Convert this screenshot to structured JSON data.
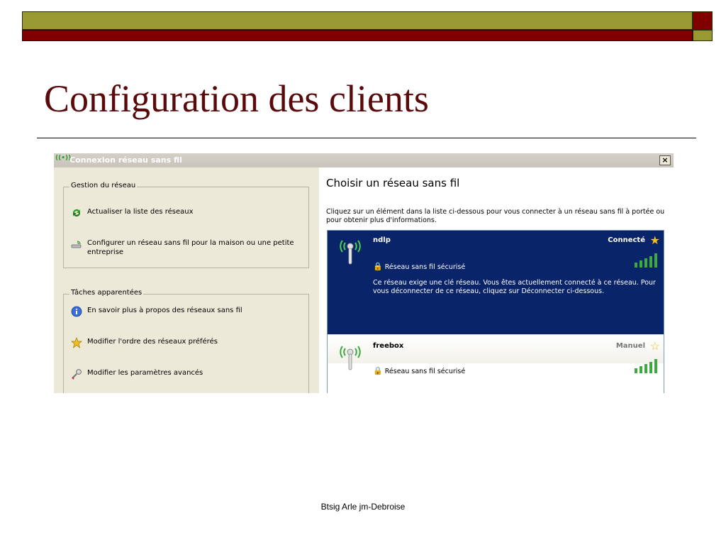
{
  "slide": {
    "title": "Configuration des clients",
    "footer": "Btsig Arle jm-Debroise"
  },
  "window": {
    "title": "Connexion réseau sans fil",
    "close_label": "×"
  },
  "left_pane": {
    "group1": {
      "legend": "Gestion du réseau",
      "items": [
        {
          "label": "Actualiser la liste des réseaux",
          "icon": "refresh-icon"
        },
        {
          "label": "Configurer un réseau sans fil pour la maison ou une petite entreprise",
          "icon": "wireless-setup-icon"
        }
      ]
    },
    "group2": {
      "legend": "Tâches apparentées",
      "items": [
        {
          "label": "En savoir plus à propos des réseaux sans fil",
          "icon": "info-icon"
        },
        {
          "label": "Modifier l'ordre des réseaux préférés",
          "icon": "star-icon"
        },
        {
          "label": "Modifier les paramètres avancés",
          "icon": "settings-icon"
        }
      ]
    }
  },
  "right_pane": {
    "title": "Choisir un réseau sans fil",
    "description": "Cliquez sur un élément dans la liste ci-dessous pour vous connecter à un réseau sans fil à portée ou pour obtenir plus d'informations.",
    "networks": [
      {
        "name": "ndlp",
        "status": "Connecté",
        "security": "Réseau sans fil sécurisé",
        "info": "Ce réseau exige une clé réseau. Vous êtes actuellement connecté à ce réseau. Pour vous déconnecter de ce réseau, cliquez sur Déconnecter ci-dessous.",
        "signal_bars": 5,
        "selected": true
      },
      {
        "name": "freebox",
        "status": "Manuel",
        "security": "Réseau sans fil sécurisé",
        "signal_bars": 5,
        "selected": false
      }
    ]
  },
  "colors": {
    "accent_olive": "#999933",
    "accent_maroon": "#800000",
    "title_color": "#5a0a0a",
    "selection_blue": "#0a246a",
    "signal_green": "#3caa3c",
    "star_gold": "#f0c020"
  }
}
